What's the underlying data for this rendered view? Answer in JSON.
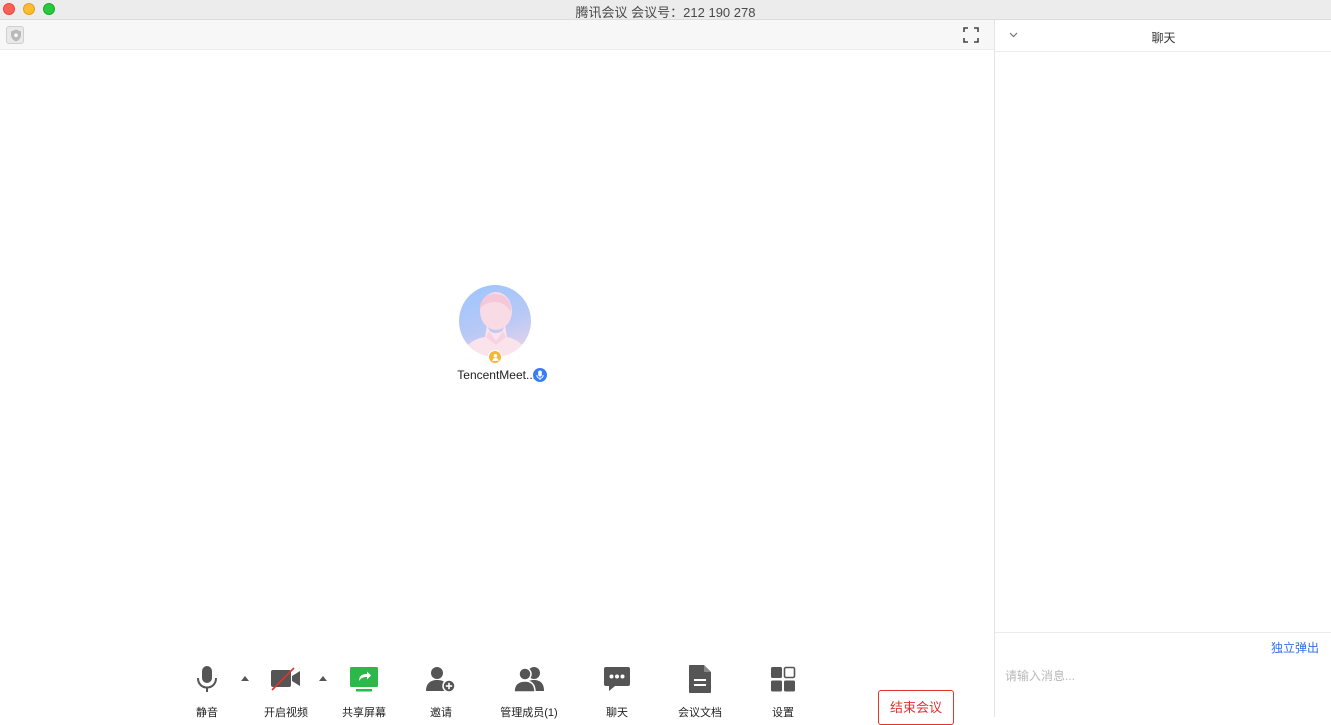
{
  "window": {
    "title": "腾讯会议 会议号：212 190 278"
  },
  "participant": {
    "name": "TencentMeet..."
  },
  "toolbar": {
    "mute_label": "静音",
    "video_label": "开启视频",
    "share_label": "共享屏幕",
    "invite_label": "邀请",
    "members_label": "管理成员(1)",
    "chat_label": "聊天",
    "docs_label": "会议文档",
    "settings_label": "设置",
    "end_label": "结束会议"
  },
  "chat": {
    "title": "聊天",
    "popout_label": "独立弹出",
    "input_placeholder": "请输入消息..."
  },
  "colors": {
    "accent": "#2f6fe8",
    "danger": "#e0342c",
    "share_green": "#2fb84a"
  }
}
